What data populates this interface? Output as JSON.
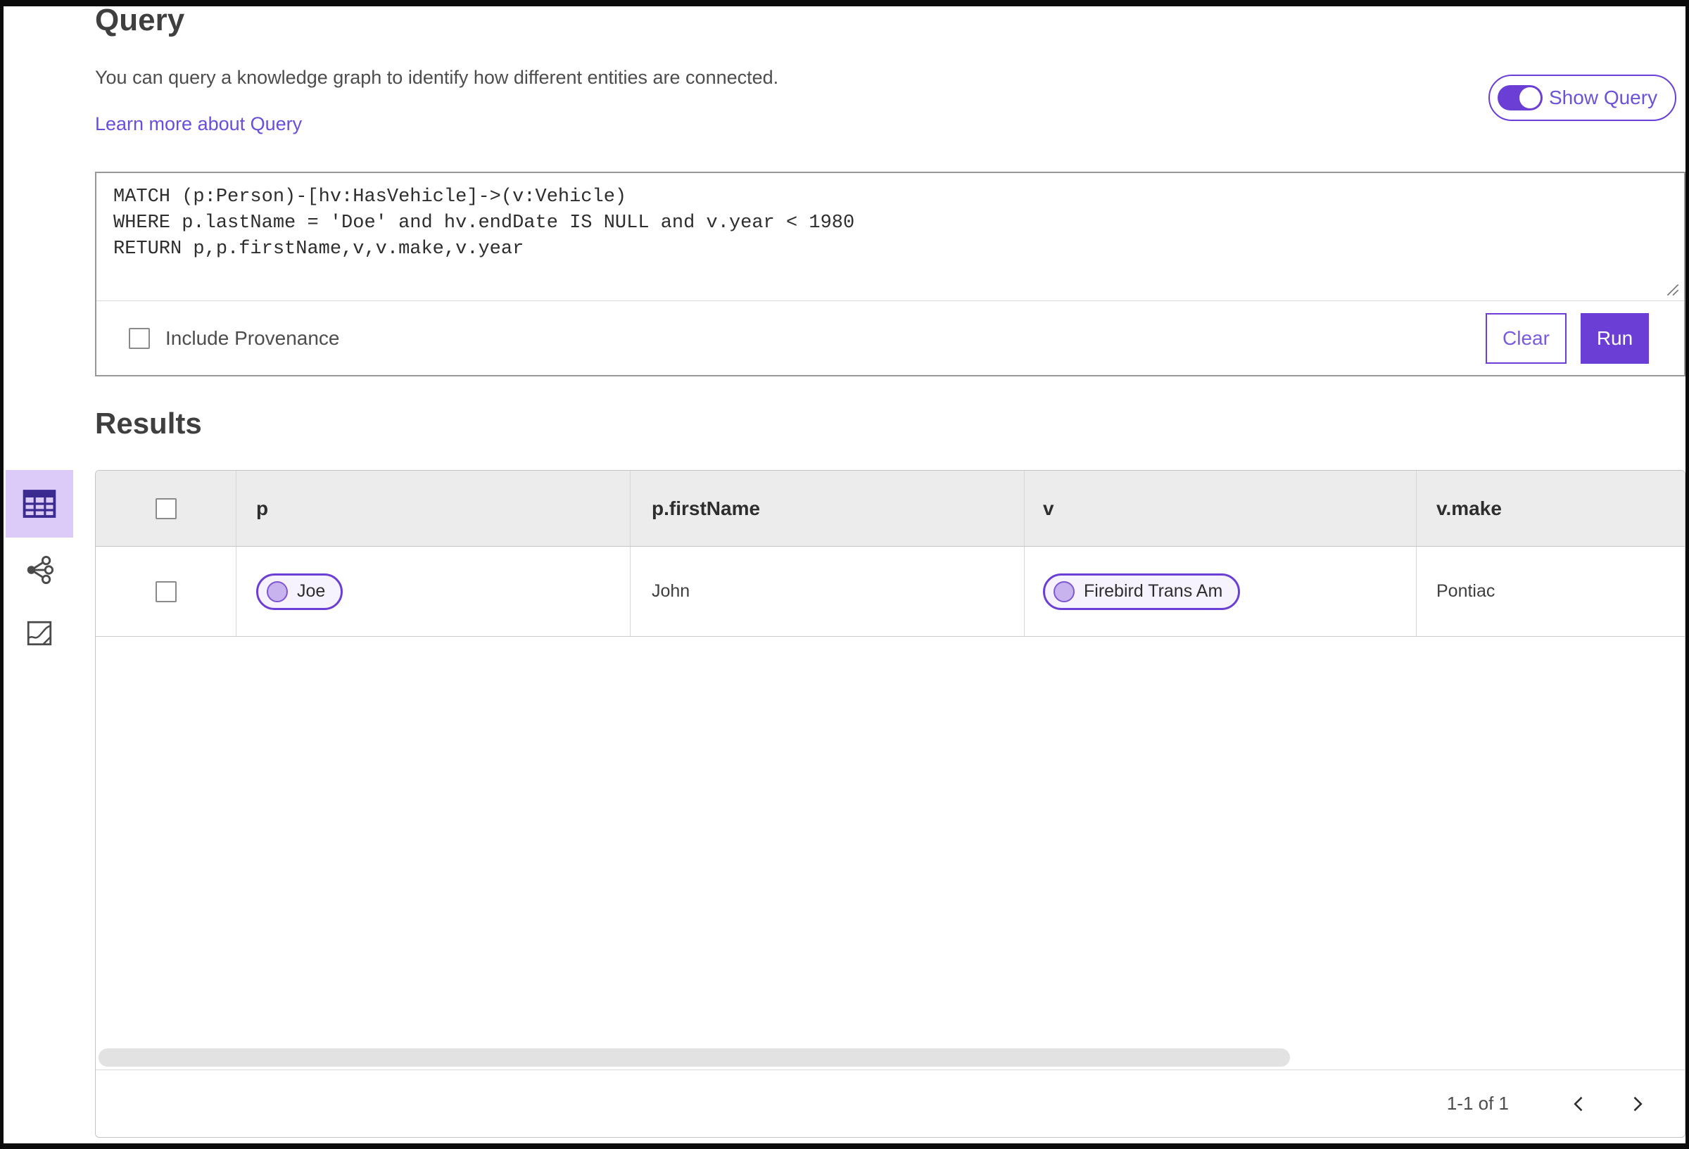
{
  "colors": {
    "accent": "#6b3fd6",
    "accent_selected_bg": "#dccbf8",
    "link": "#6a4ddd",
    "entity_pill_bg": "#f7f3fe",
    "entity_dot": "#c8b3ef",
    "table_header_bg": "#ececec"
  },
  "header": {
    "title": "Query",
    "description": "You can query a knowledge graph to identify how different entities are connected.",
    "link_label": "Learn more about Query",
    "toggle_label": "Show Query",
    "toggle_state": "on"
  },
  "query_panel": {
    "code": "MATCH (p:Person)-[hv:HasVehicle]->(v:Vehicle)\nWHERE p.lastName = 'Doe' and hv.endDate IS NULL and v.year < 1980\nRETURN p,p.firstName,v,v.make,v.year",
    "include_provenance_label": "Include Provenance",
    "include_provenance_checked": false,
    "clear_label": "Clear",
    "run_label": "Run"
  },
  "results": {
    "title": "Results",
    "view_modes": [
      {
        "icon": "table-view-icon",
        "selected": true
      },
      {
        "icon": "graph-view-icon",
        "selected": false
      },
      {
        "icon": "map-view-icon",
        "selected": false
      }
    ],
    "table": {
      "columns": [
        "p",
        "p.firstName",
        "v",
        "v.make"
      ],
      "rows": [
        {
          "p": {
            "kind": "entity-pill",
            "label": "Joe"
          },
          "p_firstName": "John",
          "v": {
            "kind": "entity-pill",
            "label": "Firebird Trans Am"
          },
          "v_make": "Pontiac",
          "checked": false
        }
      ]
    },
    "pagination": {
      "range_label": "1-1 of 1"
    }
  }
}
